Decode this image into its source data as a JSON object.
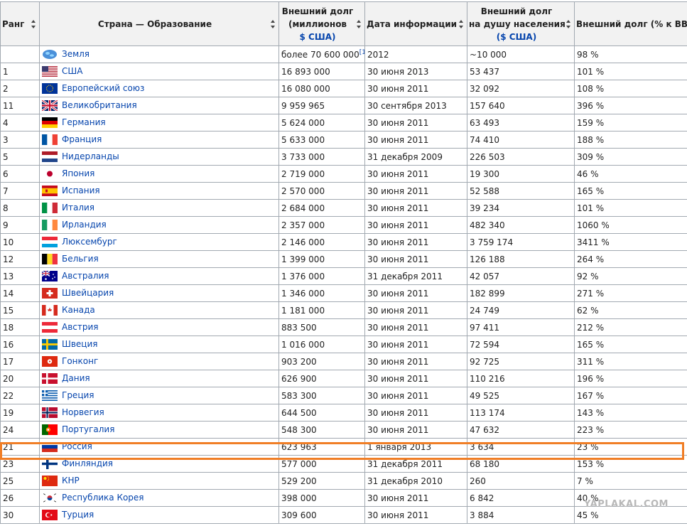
{
  "headers": {
    "rank": "Ранг",
    "country": "Страна — Образование",
    "debt_line1": "Внешний долг",
    "debt_line2": "(миллионов",
    "debt_line3": "$ США)",
    "date": "Дата информации",
    "percap_line1": "Внешний долг",
    "percap_line2": "на душу населения",
    "percap_line3": "($ США)",
    "gdp": "Внешний долг (% к ВВП)"
  },
  "rows": [
    {
      "rank": "",
      "country": "Земля",
      "flag": "globe-icon",
      "debt": "более 70 600 000",
      "note": "[1]",
      "date": "2012",
      "percap": "~10 000",
      "gdp": "98 %"
    },
    {
      "rank": "1",
      "country": "США",
      "flag": "usa-flag",
      "debt": "16 893 000",
      "date": "30 июня 2013",
      "percap": "53 437",
      "gdp": "101 %"
    },
    {
      "rank": "2",
      "country": "Европейский союз",
      "flag": "eu-flag",
      "debt": "16 080 000",
      "date": "30 июня 2011",
      "percap": "32 092",
      "gdp": "108 %"
    },
    {
      "rank": "11",
      "country": "Великобритания",
      "flag": "uk-flag",
      "debt": "9 959 965",
      "date": "30 сентября 2013",
      "percap": "157 640",
      "gdp": "396 %"
    },
    {
      "rank": "4",
      "country": "Германия",
      "flag": "germany-flag",
      "debt": "5 624 000",
      "date": "30 июня 2011",
      "percap": "63 493",
      "gdp": "159 %"
    },
    {
      "rank": "3",
      "country": "Франция",
      "flag": "france-flag",
      "debt": "5 633 000",
      "date": "30 июня 2011",
      "percap": "74 410",
      "gdp": "188 %"
    },
    {
      "rank": "5",
      "country": "Нидерланды",
      "flag": "netherlands-flag",
      "debt": "3 733 000",
      "date": "31 декабря 2009",
      "percap": "226 503",
      "gdp": "309 %"
    },
    {
      "rank": "6",
      "country": "Япония",
      "flag": "japan-flag",
      "debt": "2 719 000",
      "date": "30 июня 2011",
      "percap": "19 300",
      "gdp": "46 %"
    },
    {
      "rank": "7",
      "country": "Испания",
      "flag": "spain-flag",
      "debt": "2 570 000",
      "date": "30 июня 2011",
      "percap": "52 588",
      "gdp": "165 %"
    },
    {
      "rank": "8",
      "country": "Италия",
      "flag": "italy-flag",
      "debt": "2 684 000",
      "date": "30 июня 2011",
      "percap": "39 234",
      "gdp": "101 %"
    },
    {
      "rank": "9",
      "country": "Ирландия",
      "flag": "ireland-flag",
      "debt": "2 357 000",
      "date": "30 июня 2011",
      "percap": "482 340",
      "gdp": "1060 %"
    },
    {
      "rank": "10",
      "country": "Люксембург",
      "flag": "luxembourg-flag",
      "debt": "2 146 000",
      "date": "30 июня 2011",
      "percap": "3 759 174",
      "gdp": "3411 %"
    },
    {
      "rank": "12",
      "country": "Бельгия",
      "flag": "belgium-flag",
      "debt": "1 399 000",
      "date": "30 июня 2011",
      "percap": "126 188",
      "gdp": "264 %"
    },
    {
      "rank": "13",
      "country": "Австралия",
      "flag": "australia-flag",
      "debt": "1 376 000",
      "date": "31 декабря 2011",
      "percap": "42 057",
      "gdp": "92 %"
    },
    {
      "rank": "14",
      "country": "Швейцария",
      "flag": "switzerland-flag",
      "debt": "1 346 000",
      "date": "30 июня 2011",
      "percap": "182 899",
      "gdp": "271 %"
    },
    {
      "rank": "15",
      "country": "Канада",
      "flag": "canada-flag",
      "debt": "1 181 000",
      "date": "30 июня 2011",
      "percap": "24 749",
      "gdp": "62 %"
    },
    {
      "rank": "18",
      "country": "Австрия",
      "flag": "austria-flag",
      "debt": "883 500",
      "date": "30 июня 2011",
      "percap": "97 411",
      "gdp": "212 %"
    },
    {
      "rank": "16",
      "country": "Швеция",
      "flag": "sweden-flag",
      "debt": "1 016 000",
      "date": "30 июня 2011",
      "percap": "72 594",
      "gdp": "165 %"
    },
    {
      "rank": "17",
      "country": "Гонконг",
      "flag": "hongkong-flag",
      "debt": "903 200",
      "date": "30 июня 2011",
      "percap": "92 725",
      "gdp": "311 %"
    },
    {
      "rank": "20",
      "country": "Дания",
      "flag": "denmark-flag",
      "debt": "626 900",
      "date": "30 июня 2011",
      "percap": "110 216",
      "gdp": "196 %"
    },
    {
      "rank": "22",
      "country": "Греция",
      "flag": "greece-flag",
      "debt": "583 300",
      "date": "30 июня 2011",
      "percap": "49 525",
      "gdp": "167 %"
    },
    {
      "rank": "19",
      "country": "Норвегия",
      "flag": "norway-flag",
      "debt": "644 500",
      "date": "30 июня 2011",
      "percap": "113 174",
      "gdp": "143 %"
    },
    {
      "rank": "24",
      "country": "Португалия",
      "flag": "portugal-flag",
      "debt": "548 300",
      "date": "30 июня 2011",
      "percap": "47 632",
      "gdp": "223 %"
    },
    {
      "rank": "21",
      "country": "Россия",
      "flag": "russia-flag",
      "debt": "623 963",
      "date": "1 января 2013",
      "percap": "3 634",
      "gdp": "23 %",
      "highlight": true
    },
    {
      "rank": "23",
      "country": "Финляндия",
      "flag": "finland-flag",
      "debt": "577 000",
      "date": "31 декабря 2011",
      "percap": "68 180",
      "gdp": "153 %"
    },
    {
      "rank": "25",
      "country": "КНР",
      "flag": "china-flag",
      "debt": "529 200",
      "date": "31 декабря 2010",
      "percap": "260",
      "gdp": "7 %"
    },
    {
      "rank": "26",
      "country": "Республика Корея",
      "flag": "korea-flag",
      "debt": "398 000",
      "date": "30 июня 2011",
      "percap": "6 842",
      "gdp": "40 %"
    },
    {
      "rank": "30",
      "country": "Турция",
      "flag": "turkey-flag",
      "debt": "309 600",
      "date": "30 июня 2011",
      "percap": "3 884",
      "gdp": "45 %"
    }
  ],
  "highlight_color": "#f07e26",
  "link_color": "#0645ad",
  "watermark": "YAPLAKAL.COM"
}
